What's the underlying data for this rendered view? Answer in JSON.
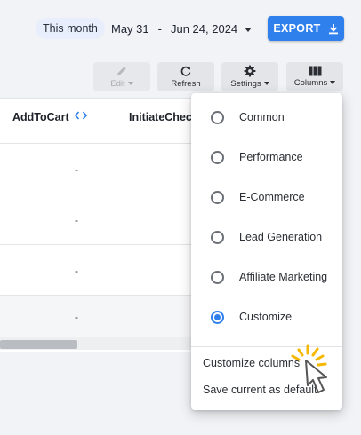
{
  "header": {
    "period_chip": "This month",
    "date_start": "May 31",
    "date_sep": "-",
    "date_end": "Jun 24, 2024",
    "export_label": "EXPORT"
  },
  "toolbar": {
    "edit_label": "Edit",
    "refresh_label": "Refresh",
    "settings_label": "Settings",
    "columns_label": "Columns"
  },
  "table": {
    "columns": [
      "AddToCart",
      "InitiateCheck"
    ],
    "rows": [
      "-",
      "-",
      "-"
    ],
    "total": "-"
  },
  "columns_menu": {
    "options": [
      {
        "label": "Common",
        "selected": false
      },
      {
        "label": "Performance",
        "selected": false
      },
      {
        "label": "E-Commerce",
        "selected": false
      },
      {
        "label": "Lead Generation",
        "selected": false
      },
      {
        "label": "Affiliate Marketing",
        "selected": false
      },
      {
        "label": "Customize",
        "selected": true
      }
    ],
    "customize_columns": "Customize columns",
    "save_default": "Save current as default"
  },
  "colors": {
    "accent": "#2f80ed",
    "highlight": "#f5b800"
  }
}
